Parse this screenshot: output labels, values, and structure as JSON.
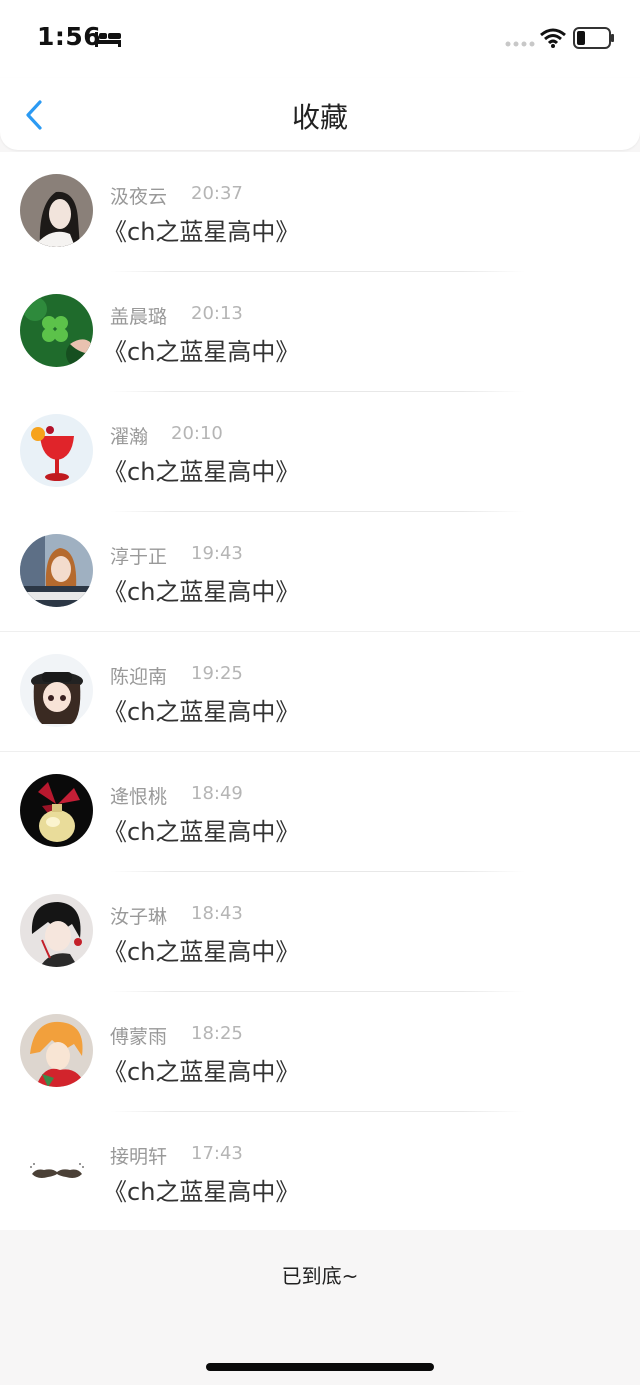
{
  "status_bar": {
    "time": "1:56"
  },
  "nav": {
    "title": "收藏"
  },
  "items": [
    {
      "name": "汲夜云",
      "time": "20:37",
      "title": "《ch之蓝星高中》",
      "avatar": "woman-dark-hair-avatar"
    },
    {
      "name": "盖晨璐",
      "time": "20:13",
      "title": "《ch之蓝星高中》",
      "avatar": "clover-avatar"
    },
    {
      "name": "濯瀚",
      "time": "20:10",
      "title": "《ch之蓝星高中》",
      "avatar": "red-drink-avatar"
    },
    {
      "name": "淳于正",
      "time": "19:43",
      "title": "《ch之蓝星高中》",
      "avatar": "girl-photo-avatar"
    },
    {
      "name": "陈迎南",
      "time": "19:25",
      "title": "《ch之蓝星高中》",
      "avatar": "cartoon-girl-hat-avatar"
    },
    {
      "name": "逄恨桃",
      "time": "18:49",
      "title": "《ch之蓝星高中》",
      "avatar": "perfume-bottle-avatar"
    },
    {
      "name": "汝子琳",
      "time": "18:43",
      "title": "《ch之蓝星高中》",
      "avatar": "anime-boy-avatar"
    },
    {
      "name": "傅蒙雨",
      "time": "18:25",
      "title": "《ch之蓝星高中》",
      "avatar": "anime-orange-hair-avatar"
    },
    {
      "name": "接明轩",
      "time": "17:43",
      "title": "《ch之蓝星高中》",
      "avatar": "mustache-avatar"
    }
  ],
  "footer": {
    "end_text": "已到底~"
  }
}
